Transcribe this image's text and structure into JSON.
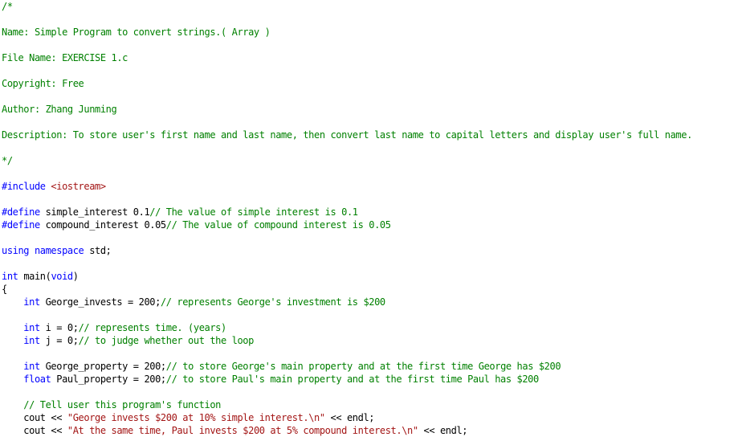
{
  "code_lines": [
    [
      {
        "t": "/*",
        "c": "cm"
      }
    ],
    [],
    [
      {
        "t": "Name: Simple Program to convert strings.( Array )",
        "c": "cm"
      }
    ],
    [],
    [
      {
        "t": "File Name: EXERCISE 1.c",
        "c": "cm"
      }
    ],
    [],
    [
      {
        "t": "Copyright: Free",
        "c": "cm"
      }
    ],
    [],
    [
      {
        "t": "Author: Zhang Junming",
        "c": "cm"
      }
    ],
    [],
    [
      {
        "t": "Description: To store user's first name and last name, then convert last name to capital letters and display user's full name.",
        "c": "cm"
      }
    ],
    [],
    [
      {
        "t": "*/",
        "c": "cm"
      }
    ],
    [],
    [
      {
        "t": "#include ",
        "c": "pp"
      },
      {
        "t": "<iostream>",
        "c": "st"
      }
    ],
    [],
    [
      {
        "t": "#define ",
        "c": "pp"
      },
      {
        "t": "simple_interest 0.1",
        "c": "tx"
      },
      {
        "t": "// The value of simple interest is 0.1",
        "c": "cm"
      }
    ],
    [
      {
        "t": "#define ",
        "c": "pp"
      },
      {
        "t": "compound_interest 0.05",
        "c": "tx"
      },
      {
        "t": "// The value of compound interest is 0.05",
        "c": "cm"
      }
    ],
    [],
    [
      {
        "t": "using namespace ",
        "c": "kw"
      },
      {
        "t": "std;",
        "c": "tx"
      }
    ],
    [],
    [
      {
        "t": "int ",
        "c": "kw"
      },
      {
        "t": "main(",
        "c": "tx"
      },
      {
        "t": "void",
        "c": "kw"
      },
      {
        "t": ")",
        "c": "tx"
      }
    ],
    [
      {
        "t": "{",
        "c": "tx"
      }
    ],
    [
      {
        "t": "    int ",
        "c": "kw"
      },
      {
        "t": "George_invests = 200;",
        "c": "tx"
      },
      {
        "t": "// represents George's investment is $200",
        "c": "cm"
      }
    ],
    [],
    [
      {
        "t": "    int ",
        "c": "kw"
      },
      {
        "t": "i = 0;",
        "c": "tx"
      },
      {
        "t": "// represents time. (years)",
        "c": "cm"
      }
    ],
    [
      {
        "t": "    int ",
        "c": "kw"
      },
      {
        "t": "j = 0;",
        "c": "tx"
      },
      {
        "t": "// to judge whether out the loop",
        "c": "cm"
      }
    ],
    [],
    [
      {
        "t": "    int ",
        "c": "kw"
      },
      {
        "t": "George_property = 200;",
        "c": "tx"
      },
      {
        "t": "// to store George's main property and at the first time George has $200",
        "c": "cm"
      }
    ],
    [
      {
        "t": "    float ",
        "c": "kw"
      },
      {
        "t": "Paul_property = 200;",
        "c": "tx"
      },
      {
        "t": "// to store Paul's main property and at the first time Paul has $200",
        "c": "cm"
      }
    ],
    [],
    [
      {
        "t": "    // Tell user this program's function",
        "c": "cm"
      }
    ],
    [
      {
        "t": "    cout << ",
        "c": "tx"
      },
      {
        "t": "\"George invests $200 at 10% simple interest.\\n\"",
        "c": "st"
      },
      {
        "t": " << endl;",
        "c": "tx"
      }
    ],
    [
      {
        "t": "    cout << ",
        "c": "tx"
      },
      {
        "t": "\"At the same time, Paul invests $200 at 5% compound interest.\\n\"",
        "c": "st"
      },
      {
        "t": " << endl;",
        "c": "tx"
      }
    ]
  ]
}
